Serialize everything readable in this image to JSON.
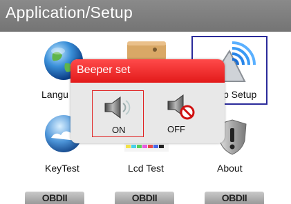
{
  "header": {
    "title": "Application/Setup"
  },
  "menu": {
    "items": [
      {
        "label": "Langu",
        "icon": "globe-icon"
      },
      {
        "label": "",
        "icon": "tool-board-icon"
      },
      {
        "label": "p Setup",
        "icon": "wireless-setup-icon"
      },
      {
        "label": "KeyTest",
        "icon": "cloud-key-icon"
      },
      {
        "label": "Lcd Test",
        "icon": "color-bars-icon"
      },
      {
        "label": "About",
        "icon": "shield-exclamation-icon"
      }
    ]
  },
  "popup": {
    "title": "Beeper set",
    "options": [
      {
        "label": "ON",
        "icon": "speaker-on-icon",
        "selected": true
      },
      {
        "label": "OFF",
        "icon": "speaker-off-icon",
        "selected": false
      }
    ]
  },
  "footer": {
    "buttons": [
      "OBDII",
      "OBDII",
      "OBDII"
    ]
  },
  "colors": {
    "popup_title": "#e62222",
    "selection_border": "#2a2a9a",
    "title_bar": "#7f7f7f"
  }
}
